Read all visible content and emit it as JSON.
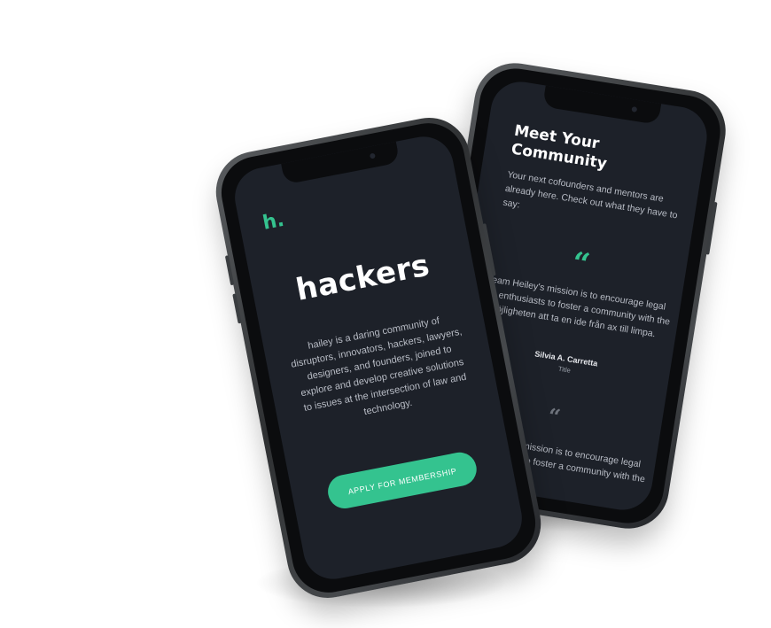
{
  "back_screen": {
    "title": "Meet Your Community",
    "subtitle": "Your next cofounders and mentors are already here. Check out what they have to say:",
    "testimonials": [
      {
        "quote_mark": "“",
        "text": "Team Heiley's mission is to encourage legal tech enthusiasts to foster a community with the möjligheten att ta en ide från ax till limpa.",
        "author": "Silvia A. Carretta",
        "role": "Title"
      },
      {
        "quote_mark": "“",
        "text": "Team Heiley's mission is to encourage legal tech enthusiasts to foster a community with the"
      }
    ]
  },
  "front_screen": {
    "logo": "h.",
    "headline": "hackers",
    "description": "hailey is a daring community of disruptors, innovators, hackers, lawyers, designers, and founders, joined to explore and develop creative solutions to issues at the intersection of law and technology.",
    "cta_label": "APPLY FOR MEMBERSHIP"
  },
  "colors": {
    "accent": "#34c38f",
    "screen_bg": "#1d2129",
    "phone_frame": "#3a3d40"
  }
}
